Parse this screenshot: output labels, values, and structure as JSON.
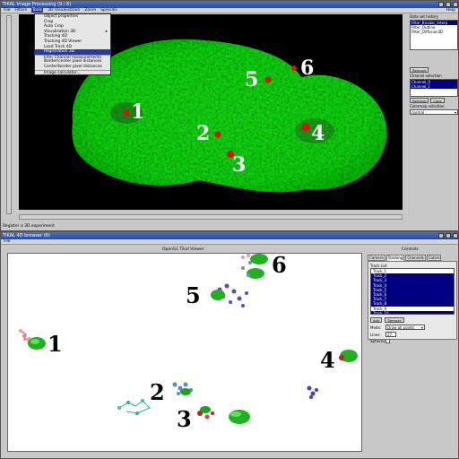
{
  "top_window": {
    "title": "TIKAL Image Processing (9 / 8)",
    "menu": [
      "File",
      "Filters",
      "Tools",
      "3D Visualization",
      "Zoom",
      "Specials"
    ],
    "active_menu_index": 2,
    "help_label": "Help",
    "tools_menu": [
      {
        "label": "Object properties",
        "selected": false,
        "submenu": false,
        "separator": false
      },
      {
        "label": "Crop",
        "selected": false,
        "submenu": false,
        "separator": false
      },
      {
        "label": "Auto Crop",
        "selected": false,
        "submenu": false,
        "separator": false
      },
      {
        "label": "Visualization 3D",
        "selected": false,
        "submenu": true,
        "separator": false
      },
      {
        "label": "Tracking 4D",
        "selected": false,
        "submenu": false,
        "separator": false
      },
      {
        "label": "Tracking 4D Viewer",
        "selected": false,
        "submenu": false,
        "separator": false
      },
      {
        "label": "Load Track 4D",
        "selected": false,
        "submenu": false,
        "separator": false
      },
      {
        "label": "Registration 3D",
        "selected": true,
        "submenu": false,
        "separator": false
      },
      {
        "label": "Inter Channel measurements",
        "selected": false,
        "submenu": false,
        "separator": true
      },
      {
        "label": "Border/center pixel distances",
        "selected": false,
        "submenu": false,
        "separator": false
      },
      {
        "label": "Center/border pixel distances",
        "selected": false,
        "submenu": false,
        "separator": false
      },
      {
        "label": "Image calculator...",
        "selected": false,
        "submenu": false,
        "separator": true
      }
    ],
    "spot_labels": [
      "1",
      "2",
      "3",
      "4",
      "5",
      "6"
    ],
    "right_panel": {
      "history_label": "Data set history",
      "history_items": [
        "Filter_Bicubic_Interp",
        "Filter_Outline",
        "Filter_Diffusion3D"
      ],
      "remove_button": "Remove",
      "channel_label": "Channel selection",
      "channels": [
        "Channel_0",
        "Channel_1"
      ],
      "remove_button_2": "Remove",
      "copy_button": "Copy",
      "colormap_label": "Colormap selection",
      "colormap_value": "normal"
    },
    "status_text": "Register a 3D experiment"
  },
  "bottom_window": {
    "title": "TIKAL 4D browser (6)",
    "menu": [
      "File"
    ],
    "viewer_heading": "OpenGL Tikal Viewer",
    "controls_heading": "Controls",
    "tabs": [
      "Camera",
      "Tracking",
      "Channels",
      "Colors"
    ],
    "active_tab_index": 1,
    "track_list_label": "Track List",
    "tracks": [
      "Track_1",
      "Track_2",
      "Track_3",
      "Track_4",
      "Track_5",
      "Track_6",
      "Track_7",
      "Track_8",
      "Track_9",
      "Track_10"
    ],
    "selected_tracks": [
      1,
      2,
      3,
      4,
      5,
      6,
      7,
      9
    ],
    "add_button": "Add",
    "remove_button": "Remove",
    "mode_label": "Mode:",
    "mode_value": "Draw all points",
    "lines_label": "Lines:",
    "lines_value": "27",
    "spheres_label": "Spheres:",
    "track_labels": [
      "1",
      "2",
      "3",
      "4",
      "5",
      "6"
    ]
  },
  "colors": {
    "spot_red": "#e01010",
    "nucleus_green": "#2a9a2a",
    "title_blue": "#2a4a9a",
    "selection_navy": "#000080"
  }
}
